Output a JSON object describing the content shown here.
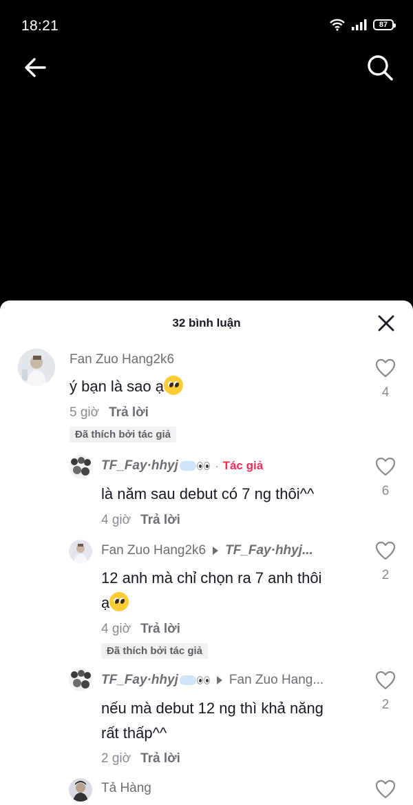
{
  "status_bar": {
    "time": "18:21",
    "battery": "87"
  },
  "sheet": {
    "title": "32 bình luận"
  },
  "comments": [
    {
      "username": "Fan Zuo Hang2k6",
      "text": "ý bạn là sao ạ",
      "time": "5 giờ",
      "reply_label": "Trả lời",
      "liked_badge": "Đã thích bởi tác giả",
      "likes": "4"
    },
    {
      "username": "TF_Fay·hhyj",
      "author_tag": "Tác giả",
      "text": "là năm sau debut có 7 ng thôi^^",
      "time": "4 giờ",
      "reply_label": "Trả lời",
      "likes": "6"
    },
    {
      "username": "Fan Zuo Hang2k6",
      "reply_to": "TF_Fay·hhyj...",
      "text_line1": "12 anh mà chỉ chọn ra 7 anh thôi",
      "text_line2": "ạ",
      "time": "4 giờ",
      "reply_label": "Trả lời",
      "liked_badge": "Đã thích bởi tác giả",
      "likes": "2"
    },
    {
      "username": "TF_Fay·hhyj",
      "reply_to": "Fan Zuo Hang...",
      "text_line1": "nếu mà debut 12 ng thì khả năng",
      "text_line2": "rất thấp^^",
      "time": "2 giờ",
      "reply_label": "Trả lời",
      "likes": "2"
    },
    {
      "username": "Tả Hàng"
    }
  ],
  "colors": {
    "accent": "#fe2c55",
    "text": "#161823",
    "muted": "#8a8b91"
  }
}
